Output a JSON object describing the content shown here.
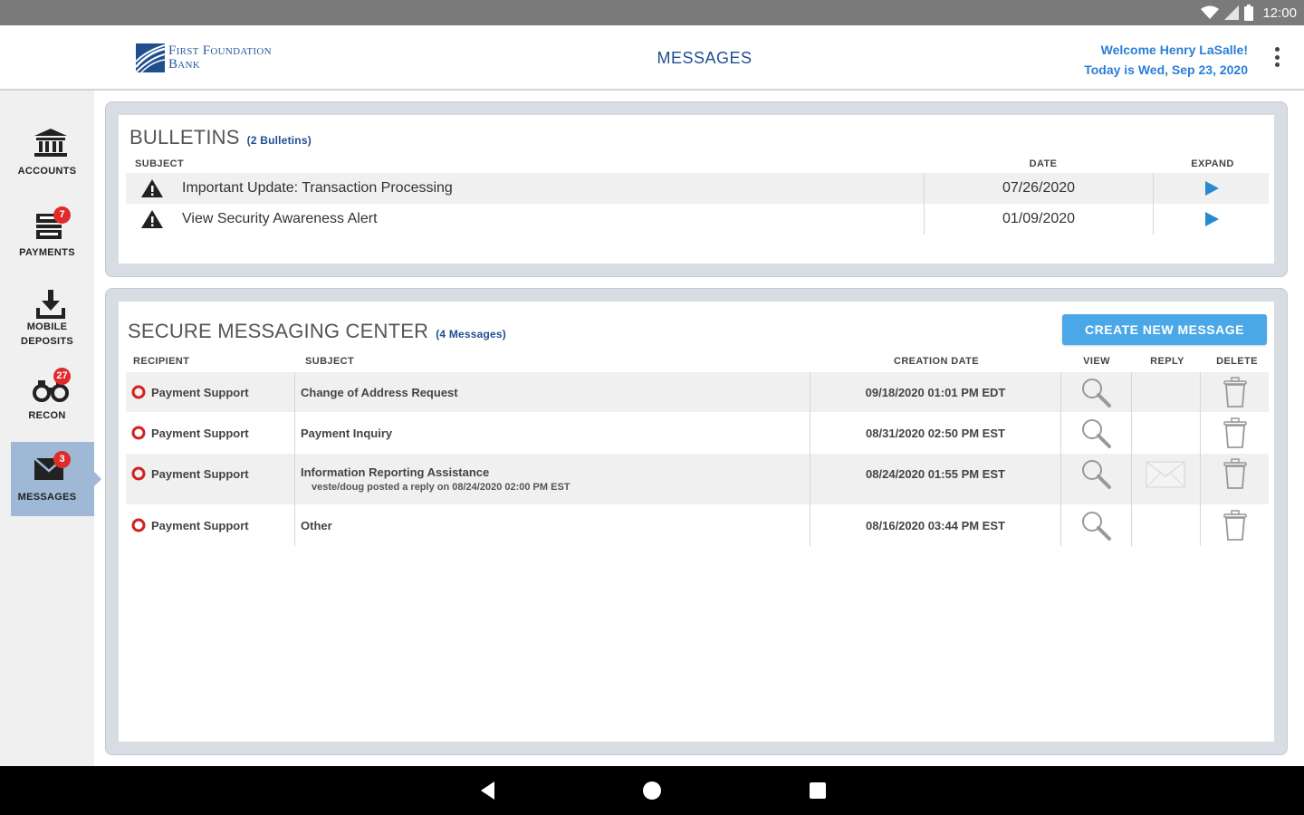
{
  "status_bar": {
    "time": "12:00"
  },
  "header": {
    "bank_name_line1": "First Foundation",
    "bank_name_line2": "Bank",
    "title": "MESSAGES",
    "welcome": "Welcome Henry LaSalle!",
    "date_line": "Today is Wed, Sep 23, 2020"
  },
  "sidebar": {
    "items": [
      {
        "label": "ACCOUNTS",
        "label2": "",
        "badge": ""
      },
      {
        "label": "PAYMENTS",
        "label2": "",
        "badge": "7"
      },
      {
        "label": "MOBILE",
        "label2": "DEPOSITS",
        "badge": ""
      },
      {
        "label": "RECON",
        "label2": "",
        "badge": "27"
      },
      {
        "label": "MESSAGES",
        "label2": "",
        "badge": "3"
      }
    ]
  },
  "bulletins": {
    "title": "BULLETINS",
    "count": "(2 Bulletins)",
    "columns": {
      "subject": "SUBJECT",
      "date": "DATE",
      "expand": "EXPAND"
    },
    "rows": [
      {
        "subject": "Important Update: Transaction Processing",
        "date": "07/26/2020"
      },
      {
        "subject": "View Security Awareness Alert",
        "date": "01/09/2020"
      }
    ]
  },
  "messages": {
    "title": "SECURE MESSAGING CENTER",
    "count": "(4 Messages)",
    "create_button": "CREATE NEW MESSAGE",
    "columns": {
      "recipient": "RECIPIENT",
      "subject": "SUBJECT",
      "creation_date": "CREATION DATE",
      "view": "VIEW",
      "reply": "REPLY",
      "delete": "DELETE"
    },
    "rows": [
      {
        "recipient": "Payment Support",
        "subject": "Change of Address Request",
        "subject_note": "",
        "date": "09/18/2020 01:01 PM EDT"
      },
      {
        "recipient": "Payment Support",
        "subject": "Payment Inquiry",
        "subject_note": "",
        "date": "08/31/2020 02:50 PM EST"
      },
      {
        "recipient": "Payment Support",
        "subject": "Information Reporting Assistance",
        "subject_note": "veste/doug posted a reply on 08/24/2020 02:00 PM EST",
        "date": "08/24/2020 01:55 PM EST"
      },
      {
        "recipient": "Payment Support",
        "subject": "Other",
        "subject_note": "",
        "date": "08/16/2020 03:44 PM EST"
      }
    ]
  },
  "colors": {
    "brand_blue": "#1f4f8f",
    "link_blue": "#2a7fd6",
    "button_blue": "#4aa8e8",
    "badge_red": "#e02b2b",
    "active_nav": "#9fb8d6"
  },
  "icons": {
    "accounts": "bank-icon",
    "payments": "payments-icon",
    "deposits": "download-icon",
    "recon": "binoculars-icon",
    "messages": "envelope-icon",
    "bulletin": "warning-icon",
    "expand": "play-icon",
    "view": "magnifier-icon",
    "reply": "envelope-icon",
    "delete": "trash-icon",
    "status": "circle-icon"
  }
}
